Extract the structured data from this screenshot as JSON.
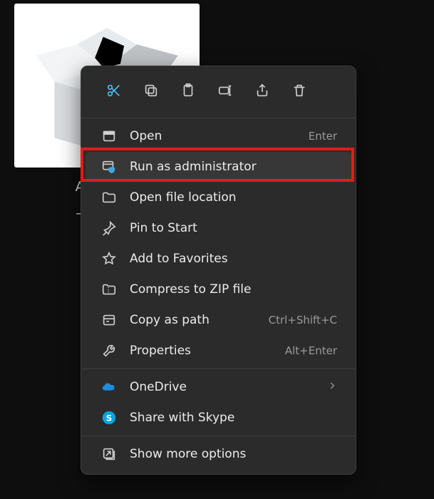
{
  "file": {
    "name_line1": "Autodesk",
    "name_line2": "_en-US_s"
  },
  "toolbar": {
    "cut": "Cut",
    "copy": "Copy",
    "paste": "Paste",
    "rename": "Rename",
    "share": "Share",
    "delete": "Delete"
  },
  "menu": {
    "open": {
      "label": "Open",
      "shortcut": "Enter"
    },
    "run_admin": {
      "label": "Run as administrator"
    },
    "open_location": {
      "label": "Open file location"
    },
    "pin_start": {
      "label": "Pin to Start"
    },
    "favorites": {
      "label": "Add to Favorites"
    },
    "compress": {
      "label": "Compress to ZIP file"
    },
    "copy_path": {
      "label": "Copy as path",
      "shortcut": "Ctrl+Shift+C"
    },
    "properties": {
      "label": "Properties",
      "shortcut": "Alt+Enter"
    },
    "onedrive": {
      "label": "OneDrive"
    },
    "skype": {
      "label": "Share with Skype"
    },
    "more": {
      "label": "Show more options"
    }
  },
  "highlighted_item": "run_admin"
}
